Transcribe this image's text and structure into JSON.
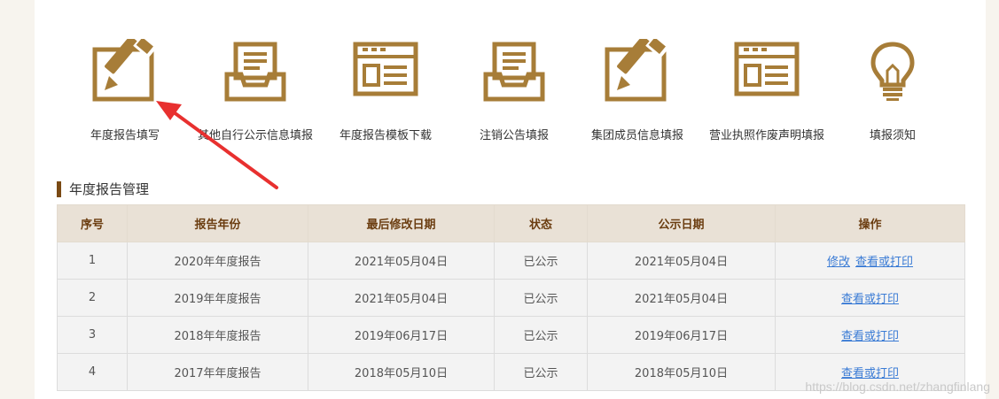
{
  "icons": [
    {
      "label": "年度报告填写",
      "icon": "pencil-edit-icon"
    },
    {
      "label": "其他自行公示信息填报",
      "icon": "document-tray-icon"
    },
    {
      "label": "年度报告模板下载",
      "icon": "template-form-icon"
    },
    {
      "label": "注销公告填报",
      "icon": "document-tray-icon"
    },
    {
      "label": "集团成员信息填报",
      "icon": "pencil-edit-icon"
    },
    {
      "label": "营业执照作废声明填报",
      "icon": "template-form-icon"
    },
    {
      "label": "填报须知",
      "icon": "lightbulb-icon"
    }
  ],
  "section": {
    "title": "年度报告管理"
  },
  "table": {
    "headers": [
      "序号",
      "报告年份",
      "最后修改日期",
      "状态",
      "公示日期",
      "操作"
    ],
    "rows": [
      {
        "no": "1",
        "year": "2020年年度报告",
        "modified": "2021年05月04日",
        "status": "已公示",
        "published": "2021年05月04日",
        "edit": "修改",
        "view": "查看或打印"
      },
      {
        "no": "2",
        "year": "2019年年度报告",
        "modified": "2021年05月04日",
        "status": "已公示",
        "published": "2021年05月04日",
        "view": "查看或打印"
      },
      {
        "no": "3",
        "year": "2018年年度报告",
        "modified": "2019年06月17日",
        "status": "已公示",
        "published": "2019年06月17日",
        "view": "查看或打印"
      },
      {
        "no": "4",
        "year": "2017年年度报告",
        "modified": "2018年05月10日",
        "status": "已公示",
        "published": "2018年05月10日",
        "view": "查看或打印"
      }
    ]
  },
  "watermark": "https://blog.csdn.net/zhangfinlang",
  "colors": {
    "icon": "#a77d38",
    "header_text": "#6b3d10",
    "link": "#3a7bd5",
    "arrow": "#e8302f"
  }
}
